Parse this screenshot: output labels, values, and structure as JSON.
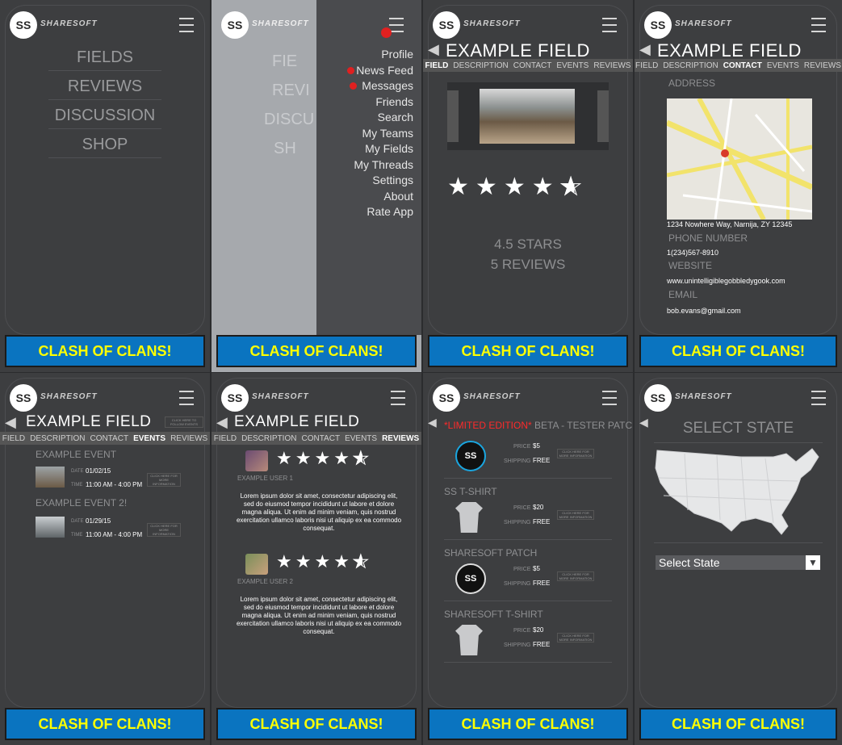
{
  "brand": {
    "logo_initials": "SS",
    "logo_text": "SHARESOFT"
  },
  "banner": "CLASH OF CLANS!",
  "main_menu": [
    "FIELDS",
    "REVIEWS",
    "DISCUSSION",
    "SHOP"
  ],
  "drawer_items": [
    "Profile",
    "News Feed",
    "Messages",
    "Friends",
    "Search",
    "My Teams",
    "My Fields",
    "My Threads",
    "Settings",
    "About",
    "Rate App"
  ],
  "drawer_partial": [
    "FIE",
    "REVI",
    "DISCU",
    "SH"
  ],
  "field_title": "EXAMPLE FIELD",
  "tabs": [
    "FIELD",
    "DESCRIPTION",
    "CONTACT",
    "EVENTS",
    "REVIEWS"
  ],
  "field_panel": {
    "rating_label": "4.5 STARS",
    "reviews_label": "5 REVIEWS",
    "rating": 4.5
  },
  "contact": {
    "address_label": "ADDRESS",
    "address": "1234 Nowhere Way, Narnija, ZY 12345",
    "phone_label": "PHONE NUMBER",
    "phone": "1(234)567-8910",
    "website_label": "WEBSITE",
    "website": "www.unintelligiblegobbledygook.com",
    "email_label": "EMAIL",
    "email": "bob.evans@gmail.com"
  },
  "events": {
    "follow_button": "CLICK HERE TO FOLLOW EVENTS",
    "date_label": "DATE",
    "time_label": "TIME",
    "more_info": "CLICK HERE FOR MORE INFORMATION",
    "list": [
      {
        "name": "EXAMPLE EVENT",
        "date": "01/02/15",
        "time": "11:00 AM - 4:00 PM"
      },
      {
        "name": "EXAMPLE EVENT 2!",
        "date": "01/29/15",
        "time": "11:00 AM - 4:00 PM"
      }
    ]
  },
  "reviews": [
    {
      "user": "EXAMPLE USER 1",
      "rating": 4.5,
      "text": "Lorem ipsum dolor sit amet, consectetur adipiscing elit, sed do eiusmod tempor incididunt ut labore et dolore magna aliqua. Ut enim ad minim veniam, quis nostrud exercitation ullamco laboris nisi ut aliquip ex ea commodo consequat."
    },
    {
      "user": "EXAMPLE USER 2",
      "rating": 4.5,
      "text": "Lorem ipsum dolor sit amet, consectetur adipiscing elit, sed do eiusmod tempor incididunt ut labore et dolore magna aliqua. Ut enim ad minim veniam, quis nostrud exercitation ullamco laboris nisi ut aliquip ex ea commodo consequat."
    }
  ],
  "shop": {
    "limited": "*LIMITED EDITION*",
    "price_label": "PRICE",
    "shipping_label": "SHIPPING",
    "more_info": "CLICK HERE FOR MORE INFORMATION",
    "items": [
      {
        "name": " BETA - TESTER PATCH",
        "price": "$5",
        "shipping": "FREE",
        "kind": "patch-blue"
      },
      {
        "name": "SS T-SHIRT",
        "price": "$20",
        "shipping": "FREE",
        "kind": "shirt"
      },
      {
        "name": "SHARESOFT PATCH",
        "price": "$5",
        "shipping": "FREE",
        "kind": "patch-black"
      },
      {
        "name": "SHARESOFT T-SHIRT",
        "price": "$20",
        "shipping": "FREE",
        "kind": "shirt"
      }
    ]
  },
  "state": {
    "title": "SELECT STATE",
    "select_value": "Select State"
  },
  "colors": {
    "banner_bg": "#0a74c0",
    "banner_text": "#ffff00",
    "panel_bg": "#3d3e40",
    "notification": "#e02020",
    "limited": "#ff2a2a"
  }
}
